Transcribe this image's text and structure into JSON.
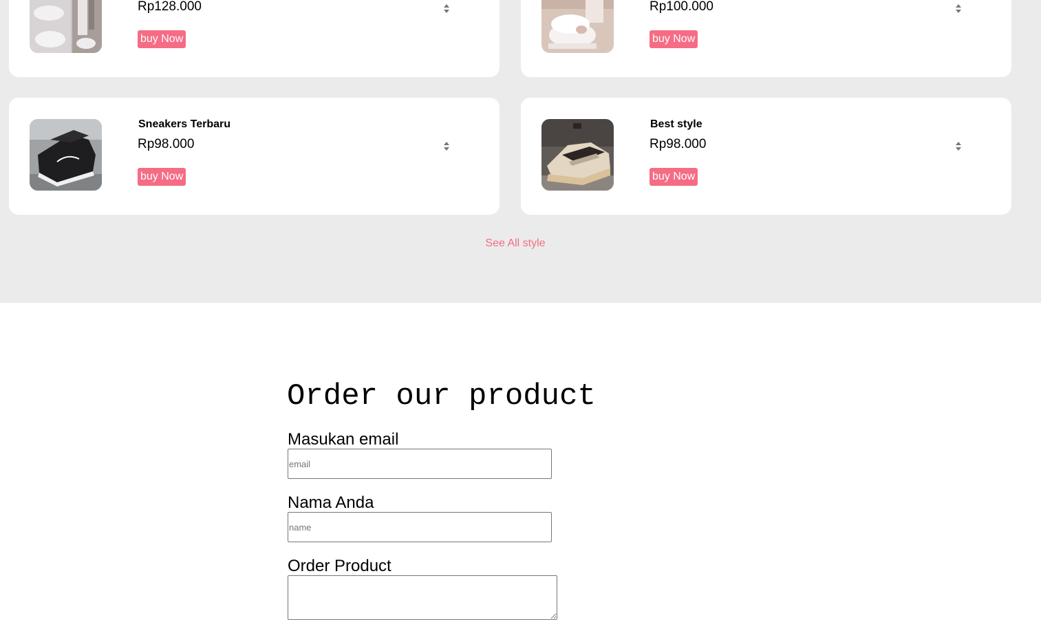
{
  "products": [
    {
      "name": "",
      "price": "Rp128.000",
      "buy_label": "buy Now",
      "image": "white-chunky-sneakers-photo"
    },
    {
      "name": "",
      "price": "Rp100.000",
      "buy_label": "buy Now",
      "image": "white-platform-sneakers-photo"
    },
    {
      "name": "Sneakers Terbaru",
      "price": "Rp98.000",
      "buy_label": "buy Now",
      "image": "black-sneakers-photo"
    },
    {
      "name": "Best style",
      "price": "Rp98.000",
      "buy_label": "buy Now",
      "image": "beige-retro-sneakers-photo"
    }
  ],
  "see_all_label": "See All style",
  "order_form": {
    "title": "Order our product",
    "email_label": "Masukan email",
    "email_placeholder": "email",
    "name_label": "Nama Anda",
    "name_placeholder": "name",
    "product_label": "Order Product",
    "product_value": ""
  },
  "colors": {
    "accent": "#f56c84",
    "section_background": "#ebebeb",
    "card_background": "#ffffff"
  }
}
